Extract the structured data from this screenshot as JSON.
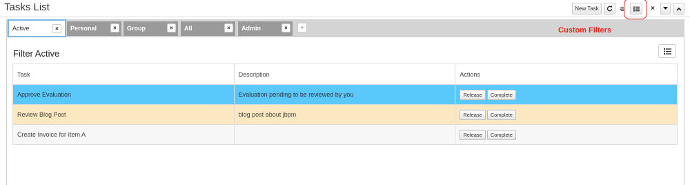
{
  "header": {
    "title": "Tasks List",
    "new_task_label": "New Task"
  },
  "tabs": [
    {
      "label": "Active"
    },
    {
      "label": "Personal"
    },
    {
      "label": "Group"
    },
    {
      "label": "All"
    },
    {
      "label": "Admin"
    }
  ],
  "tab_add_label": "+",
  "close_glyph": "×",
  "annotation": "Custom Filters",
  "main": {
    "title": "Filter Active"
  },
  "table": {
    "columns": [
      "Task",
      "Description",
      "Actions"
    ],
    "rows": [
      {
        "task": "Approve Evaluation",
        "description": "Evaluation pending to be reviewed by you",
        "release": "Release",
        "complete": "Complete"
      },
      {
        "task": "Review Blog Post",
        "description": "blog post about jbpm",
        "release": "Release",
        "complete": "Complete"
      },
      {
        "task": "Create Invoice for Item A",
        "description": "",
        "release": "Release",
        "complete": "Complete"
      }
    ]
  },
  "colors": {
    "selected_row": "#5bc8fb",
    "warning_row": "#fce8c0",
    "annotation": "#e2231a"
  }
}
